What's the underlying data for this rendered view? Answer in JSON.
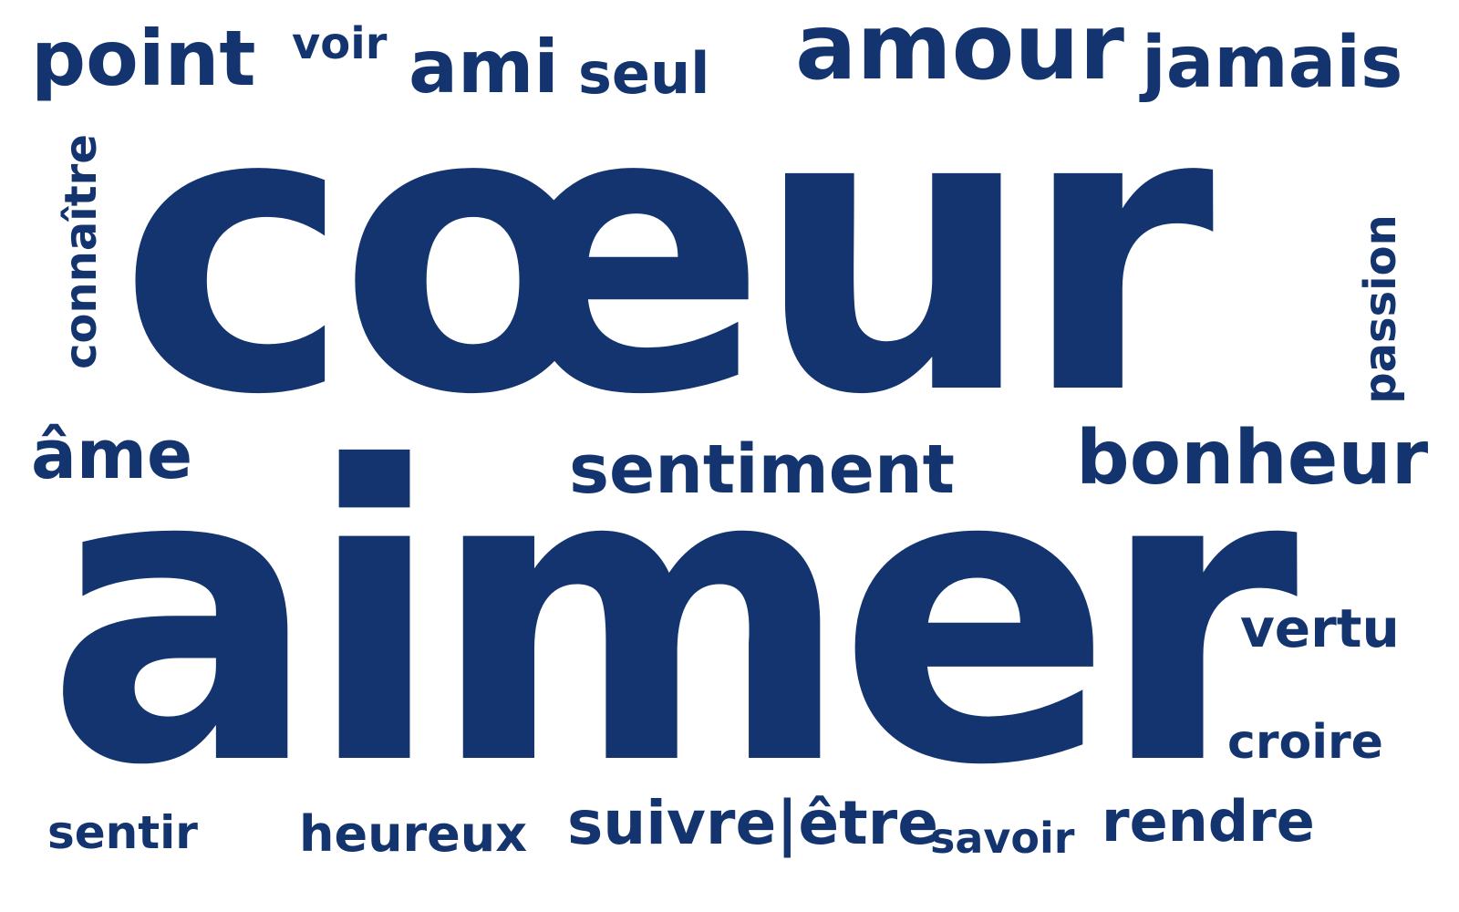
{
  "cloud": {
    "color": "#13346f",
    "background": "#ffffff",
    "words": {
      "coeur": "cœur",
      "aimer": "aimer",
      "point": "point",
      "voir": "voir",
      "ami": "ami",
      "seul": "seul",
      "amour": "amour",
      "jamais": "jamais",
      "connaitre": "connaître",
      "passion": "passion",
      "ame": "âme",
      "sentiment": "sentiment",
      "bonheur": "bonheur",
      "vertu": "vertu",
      "croire": "croire",
      "sentir": "sentir",
      "heureux": "heureux",
      "suivre_etre": "suivre|être",
      "savoir": "savoir",
      "rendre": "rendre"
    }
  }
}
